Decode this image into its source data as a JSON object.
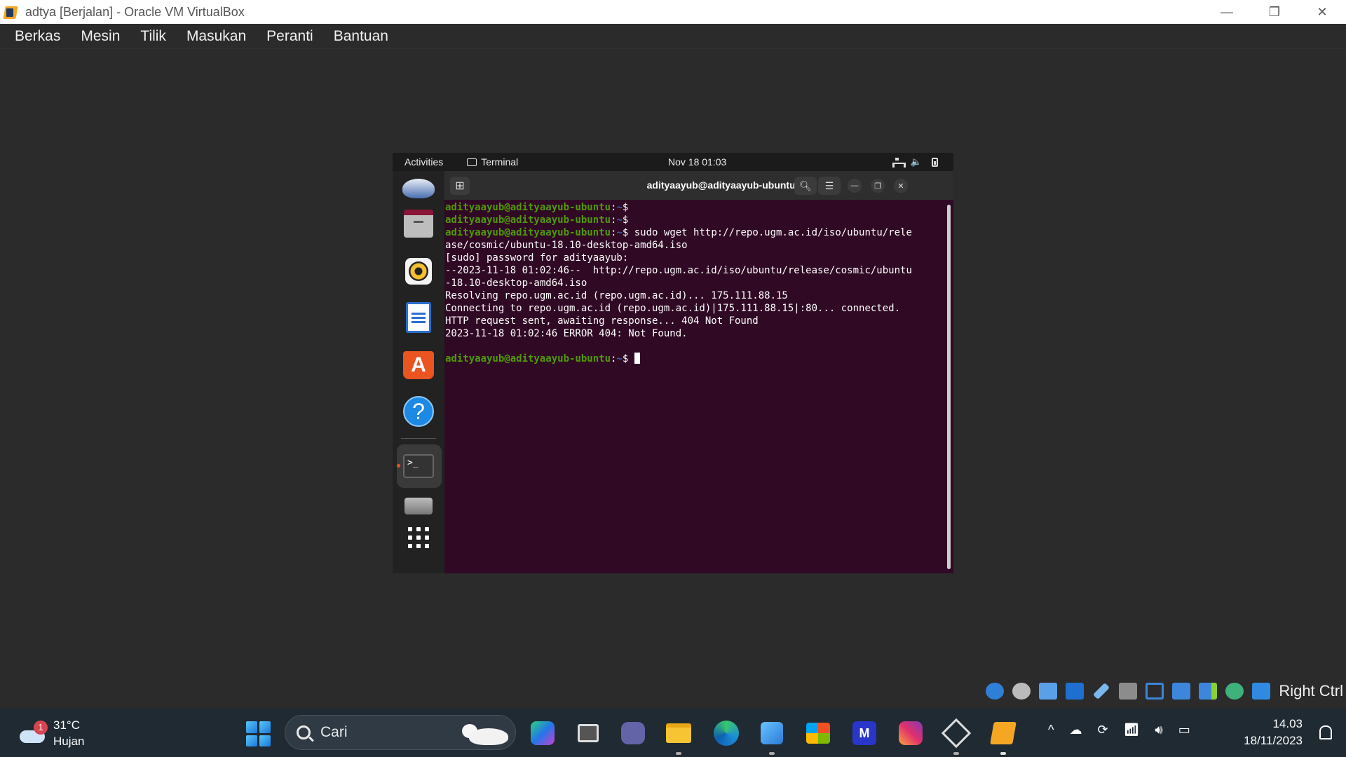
{
  "window": {
    "title": "adtya [Berjalan] - Oracle VM VirtualBox",
    "controls": {
      "minimize": "—",
      "restore": "❐",
      "close": "✕"
    }
  },
  "menu": [
    "Berkas",
    "Mesin",
    "Tilik",
    "Masukan",
    "Peranti",
    "Bantuan"
  ],
  "guest": {
    "topbar": {
      "activities": "Activities",
      "app": "Terminal",
      "clock": "Nov 18  01:03"
    },
    "dock": [
      "thunderbird-icon",
      "files-icon",
      "rhythmbox-icon",
      "libreoffice-writer-icon",
      "software-center-icon",
      "help-icon",
      "terminal-icon",
      "drive-icon",
      "show-apps-icon"
    ],
    "terminal": {
      "title": "adityaayub@adityaayub-ubuntu: ~",
      "prompt_user": "adityaayub@adityaayub-ubuntu",
      "prompt_path": "~",
      "lines": [
        {
          "type": "prompt",
          "cmd": ""
        },
        {
          "type": "prompt",
          "cmd": ""
        },
        {
          "type": "prompt",
          "cmd": " sudo wget http://repo.ugm.ac.id/iso/ubuntu/rele"
        },
        {
          "type": "out",
          "text": "ase/cosmic/ubuntu-18.10-desktop-amd64.iso"
        },
        {
          "type": "out",
          "text": "[sudo] password for adityaayub:"
        },
        {
          "type": "out",
          "text": "--2023-11-18 01:02:46--  http://repo.ugm.ac.id/iso/ubuntu/release/cosmic/ubuntu"
        },
        {
          "type": "out",
          "text": "-18.10-desktop-amd64.iso"
        },
        {
          "type": "out",
          "text": "Resolving repo.ugm.ac.id (repo.ugm.ac.id)... 175.111.88.15"
        },
        {
          "type": "out",
          "text": "Connecting to repo.ugm.ac.id (repo.ugm.ac.id)|175.111.88.15|:80... connected."
        },
        {
          "type": "out",
          "text": "HTTP request sent, awaiting response... 404 Not Found"
        },
        {
          "type": "out",
          "text": "2023-11-18 01:02:46 ERROR 404: Not Found."
        },
        {
          "type": "blank"
        },
        {
          "type": "prompt",
          "cmd": " ",
          "cursor": true
        }
      ]
    }
  },
  "vbox_status": {
    "host_key": "Right Ctrl"
  },
  "taskbar": {
    "weather": {
      "badge": "1",
      "temp": "31°C",
      "cond": "Hujan"
    },
    "search_placeholder": "Cari",
    "time": "14.03",
    "date": "18/11/2023"
  }
}
